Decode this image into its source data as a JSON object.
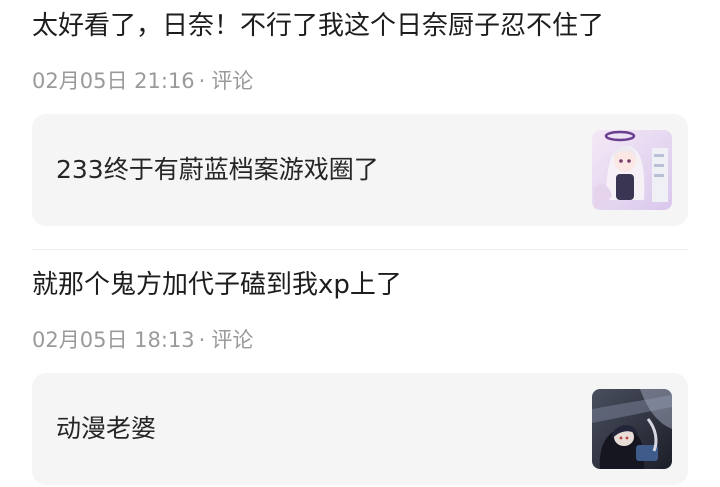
{
  "comments": [
    {
      "text": "太好看了，日奈！不行了我这个日奈厨子忍不住了",
      "date": "02月05日",
      "time": "21:16",
      "separator": "·",
      "reply_label": "评论",
      "card": {
        "text": "233终于有蔚蓝档案游戏圈了",
        "thumbnail_icon": "anime-girl-thumbnail"
      }
    },
    {
      "text": "就那个鬼方加代子磕到我xp上了",
      "date": "02月05日",
      "time": "18:13",
      "separator": "·",
      "reply_label": "评论",
      "card": {
        "text": "动漫老婆",
        "thumbnail_icon": "anime-girl-dark-thumbnail"
      }
    }
  ],
  "colors": {
    "meta_text": "#9a9a9a",
    "card_bg": "#f5f5f5",
    "body_text": "#1d1d1d"
  }
}
